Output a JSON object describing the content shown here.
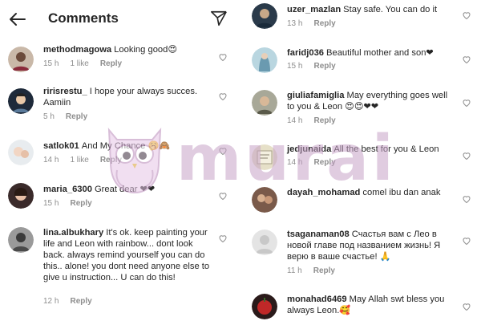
{
  "header": {
    "title": "Comments",
    "back_icon": "arrow-left-icon",
    "send_icon": "paper-plane-icon"
  },
  "left_comments": [
    {
      "username": "methodmagowa",
      "text": "Looking good😍",
      "time": "15 h",
      "likes": "1 like",
      "reply": "Reply",
      "avatar_color": "#6b4a3a"
    },
    {
      "username": "ririsrestu_",
      "text": "I hope your always succes. Aamiin",
      "time": "5 h",
      "likes": "",
      "reply": "Reply",
      "avatar_color": "#1e2a3a"
    },
    {
      "username": "satlok01",
      "text": "And My Chance 🥱🙈",
      "time": "14 h",
      "likes": "1 like",
      "reply": "Reply",
      "avatar_color": "#d9cfc6"
    },
    {
      "username": "maria_6300",
      "text": "Great dear ❤❤",
      "time": "15 h",
      "likes": "",
      "reply": "Reply",
      "avatar_color": "#3a2a2a"
    },
    {
      "username": "lina.albukhary",
      "text": "It's ok. keep painting your life and Leon with rainbow... dont look back. always remind yourself you can do this.. alone! you dont need anyone else to give u instruction... U can do this!",
      "time": "12 h",
      "likes": "",
      "reply": "Reply",
      "avatar_color": "#4a4a4a"
    }
  ],
  "right_comments": [
    {
      "username": "uzer_mazlan",
      "text": "Stay safe. You can do it",
      "time": "13 h",
      "likes": "",
      "reply": "Reply",
      "avatar_color": "#2a3a4a"
    },
    {
      "username": "faridj036",
      "text": "Beautiful mother and son❤",
      "time": "15 h",
      "likes": "",
      "reply": "Reply",
      "avatar_color": "#8fb9c9"
    },
    {
      "username": "giuliafamiglia",
      "text": "May everything goes well to you & Leon 😍😍❤❤",
      "time": "14 h",
      "likes": "",
      "reply": "Reply",
      "avatar_color": "#9a9a8a"
    },
    {
      "username": "jedjunaida",
      "text": "All the best for you & Leon",
      "time": "14 h",
      "likes": "",
      "reply": "Reply",
      "avatar_color": "#d8d2b8"
    },
    {
      "username": "dayah_mohamad",
      "text": "comel ibu dan anak",
      "time": "",
      "likes": "",
      "reply": "",
      "avatar_color": "#7a5a4a"
    },
    {
      "username": "tsaganaman08",
      "text": "Счастья вам с Лео в новой главе под названием жизнь! Я верю в ваше счастье! 🙏",
      "time": "11 h",
      "likes": "",
      "reply": "Reply",
      "avatar_color": "#e4e4e4"
    },
    {
      "username": "monahad6469",
      "text": "May Allah swt bless you always Leon.🥰",
      "time": "",
      "likes": "",
      "reply": "",
      "avatar_color": "#b03030"
    }
  ],
  "watermark": {
    "text": "murai"
  },
  "colors": {
    "text": "#262626",
    "meta": "#8e8e8e",
    "heart": "#8e8e8e",
    "watermark": "#c7a3c7"
  }
}
